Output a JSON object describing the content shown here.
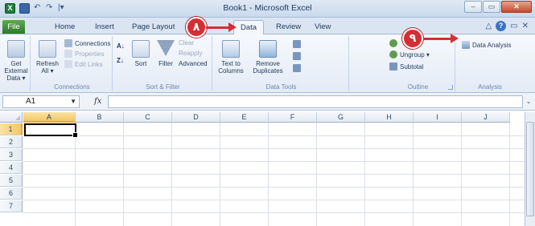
{
  "window": {
    "title": "Book1 - Microsoft Excel",
    "controls": {
      "minimize": "–",
      "maximize": "▭",
      "close": "✕"
    }
  },
  "qat": {
    "logo": "X",
    "undo": "↶",
    "redo": "↷",
    "customize": "|▾"
  },
  "tabs": [
    "File",
    "Home",
    "Insert",
    "Page Layout",
    "Data",
    "Review",
    "View"
  ],
  "active_tab": "Data",
  "tab_right": {
    "help": "?",
    "minimize_ribbon": "△",
    "restore": "▭",
    "close": "✕"
  },
  "ribbon": {
    "get_external": {
      "label1": "Get External",
      "label2": "Data ▾"
    },
    "connections": {
      "refresh1": "Refresh",
      "refresh2": "All ▾",
      "connections": "Connections",
      "properties": "Properties",
      "edit_links": "Edit Links",
      "group_label": "Connections"
    },
    "sort_filter": {
      "sort": "Sort",
      "filter": "Filter",
      "clear": "Clear",
      "reapply": "Reapply",
      "advanced": "Advanced",
      "az": "A↓",
      "za": "Z↓",
      "group_label": "Sort & Filter"
    },
    "data_tools": {
      "text_to_columns1": "Text to",
      "text_to_columns2": "Columns",
      "remove_duplicates1": "Remove",
      "remove_duplicates2": "Duplicates",
      "group_label": "Data Tools"
    },
    "outline": {
      "group": "Group ▾",
      "ungroup": "Ungroup ▾",
      "subtotal": "Subtotal",
      "group_label": "Outline"
    },
    "analysis": {
      "data_analysis": "Data Analysis",
      "group_label": "Analysis"
    }
  },
  "formula_bar": {
    "name_box": "A1",
    "fx": "fx",
    "formula": ""
  },
  "columns": [
    "A",
    "B",
    "C",
    "D",
    "E",
    "F",
    "G",
    "H",
    "I",
    "J"
  ],
  "rows": [
    "1",
    "2",
    "3",
    "4",
    "5",
    "6",
    "7"
  ],
  "selected_cell": "A1",
  "callouts": {
    "step_tab": "٨",
    "step_button": "٩"
  },
  "colors": {
    "callout": "#d32f34",
    "selection": "#f3c765",
    "file_tab": "#2e7a2b"
  }
}
